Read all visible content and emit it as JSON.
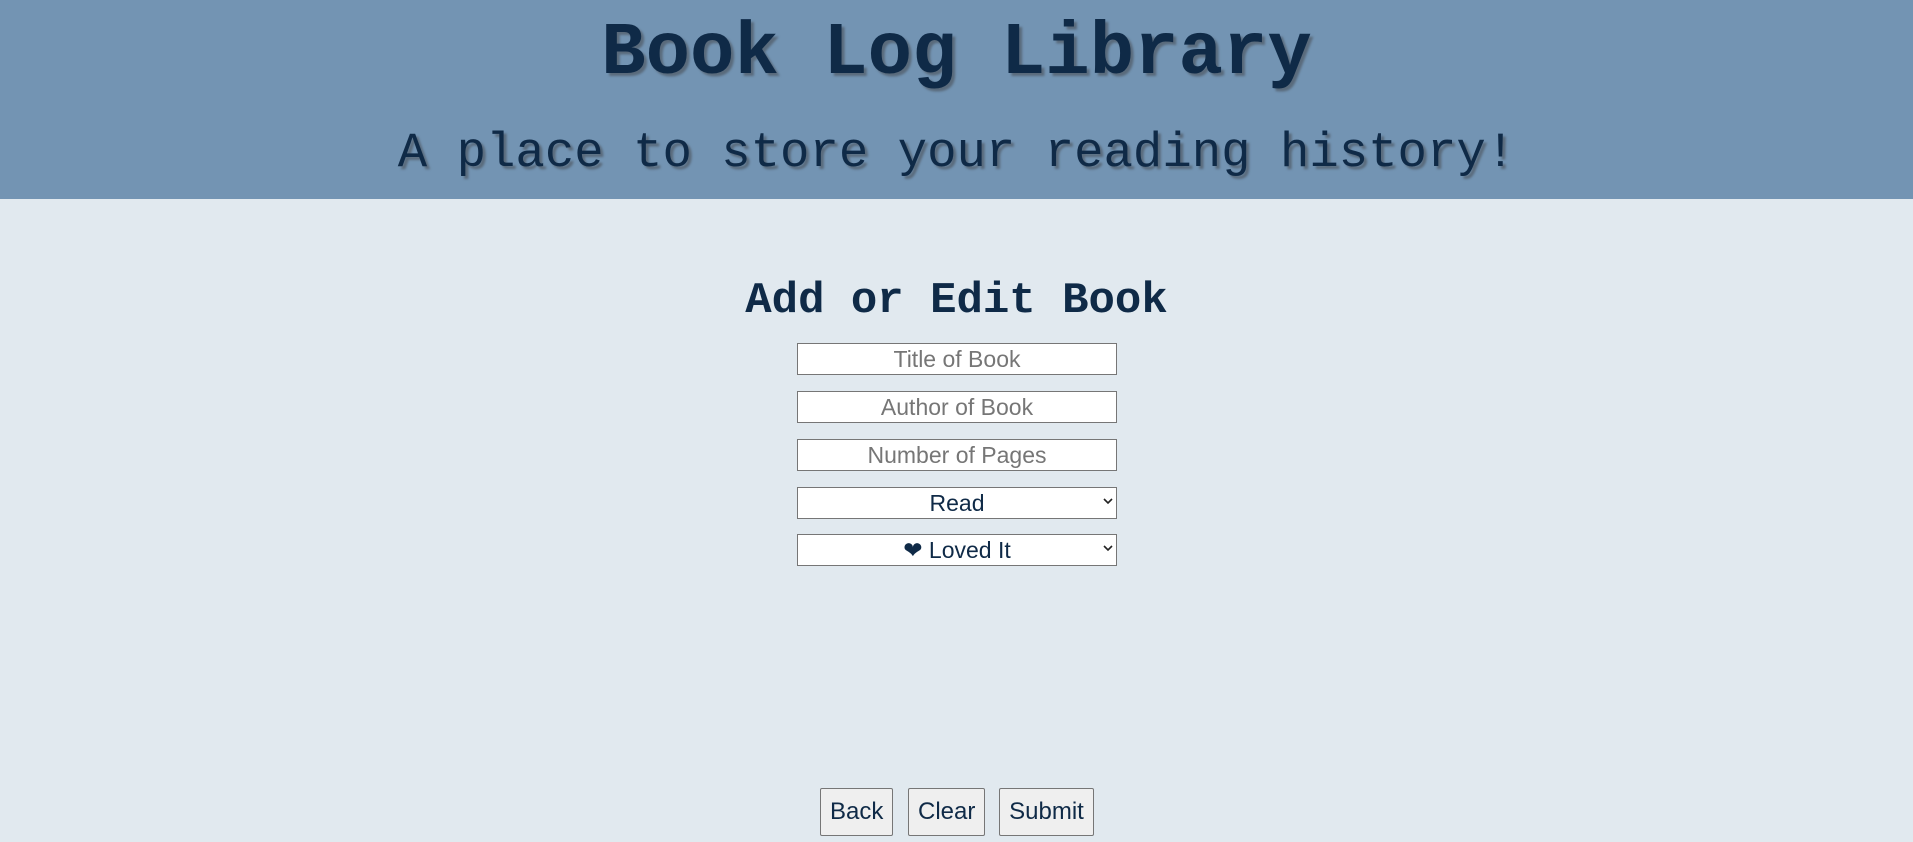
{
  "header": {
    "title": "Book Log Library",
    "subtitle": "A place to store your reading history!"
  },
  "form": {
    "heading": "Add or Edit Book",
    "title_placeholder": "Title of Book",
    "author_placeholder": "Author of Book",
    "pages_placeholder": "Number of Pages",
    "status": {
      "selected": "Read",
      "icon": "chevron-down-icon"
    },
    "rating": {
      "selected": "❤ Loved It",
      "icon": "chevron-down-icon"
    },
    "buttons": {
      "back": "Back",
      "clear": "Clear",
      "submit": "Submit"
    }
  },
  "colors": {
    "header_bg": "#7394b3",
    "page_bg": "#e1e9ef",
    "text": "#0f2a47"
  }
}
